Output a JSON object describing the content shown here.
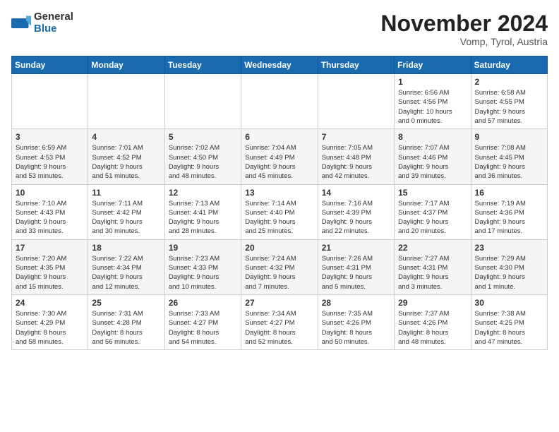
{
  "logo": {
    "general": "General",
    "blue": "Blue"
  },
  "header": {
    "month": "November 2024",
    "location": "Vomp, Tyrol, Austria"
  },
  "weekdays": [
    "Sunday",
    "Monday",
    "Tuesday",
    "Wednesday",
    "Thursday",
    "Friday",
    "Saturday"
  ],
  "weeks": [
    [
      {
        "day": "",
        "info": ""
      },
      {
        "day": "",
        "info": ""
      },
      {
        "day": "",
        "info": ""
      },
      {
        "day": "",
        "info": ""
      },
      {
        "day": "",
        "info": ""
      },
      {
        "day": "1",
        "info": "Sunrise: 6:56 AM\nSunset: 4:56 PM\nDaylight: 10 hours\nand 0 minutes."
      },
      {
        "day": "2",
        "info": "Sunrise: 6:58 AM\nSunset: 4:55 PM\nDaylight: 9 hours\nand 57 minutes."
      }
    ],
    [
      {
        "day": "3",
        "info": "Sunrise: 6:59 AM\nSunset: 4:53 PM\nDaylight: 9 hours\nand 53 minutes."
      },
      {
        "day": "4",
        "info": "Sunrise: 7:01 AM\nSunset: 4:52 PM\nDaylight: 9 hours\nand 51 minutes."
      },
      {
        "day": "5",
        "info": "Sunrise: 7:02 AM\nSunset: 4:50 PM\nDaylight: 9 hours\nand 48 minutes."
      },
      {
        "day": "6",
        "info": "Sunrise: 7:04 AM\nSunset: 4:49 PM\nDaylight: 9 hours\nand 45 minutes."
      },
      {
        "day": "7",
        "info": "Sunrise: 7:05 AM\nSunset: 4:48 PM\nDaylight: 9 hours\nand 42 minutes."
      },
      {
        "day": "8",
        "info": "Sunrise: 7:07 AM\nSunset: 4:46 PM\nDaylight: 9 hours\nand 39 minutes."
      },
      {
        "day": "9",
        "info": "Sunrise: 7:08 AM\nSunset: 4:45 PM\nDaylight: 9 hours\nand 36 minutes."
      }
    ],
    [
      {
        "day": "10",
        "info": "Sunrise: 7:10 AM\nSunset: 4:43 PM\nDaylight: 9 hours\nand 33 minutes."
      },
      {
        "day": "11",
        "info": "Sunrise: 7:11 AM\nSunset: 4:42 PM\nDaylight: 9 hours\nand 30 minutes."
      },
      {
        "day": "12",
        "info": "Sunrise: 7:13 AM\nSunset: 4:41 PM\nDaylight: 9 hours\nand 28 minutes."
      },
      {
        "day": "13",
        "info": "Sunrise: 7:14 AM\nSunset: 4:40 PM\nDaylight: 9 hours\nand 25 minutes."
      },
      {
        "day": "14",
        "info": "Sunrise: 7:16 AM\nSunset: 4:39 PM\nDaylight: 9 hours\nand 22 minutes."
      },
      {
        "day": "15",
        "info": "Sunrise: 7:17 AM\nSunset: 4:37 PM\nDaylight: 9 hours\nand 20 minutes."
      },
      {
        "day": "16",
        "info": "Sunrise: 7:19 AM\nSunset: 4:36 PM\nDaylight: 9 hours\nand 17 minutes."
      }
    ],
    [
      {
        "day": "17",
        "info": "Sunrise: 7:20 AM\nSunset: 4:35 PM\nDaylight: 9 hours\nand 15 minutes."
      },
      {
        "day": "18",
        "info": "Sunrise: 7:22 AM\nSunset: 4:34 PM\nDaylight: 9 hours\nand 12 minutes."
      },
      {
        "day": "19",
        "info": "Sunrise: 7:23 AM\nSunset: 4:33 PM\nDaylight: 9 hours\nand 10 minutes."
      },
      {
        "day": "20",
        "info": "Sunrise: 7:24 AM\nSunset: 4:32 PM\nDaylight: 9 hours\nand 7 minutes."
      },
      {
        "day": "21",
        "info": "Sunrise: 7:26 AM\nSunset: 4:31 PM\nDaylight: 9 hours\nand 5 minutes."
      },
      {
        "day": "22",
        "info": "Sunrise: 7:27 AM\nSunset: 4:31 PM\nDaylight: 9 hours\nand 3 minutes."
      },
      {
        "day": "23",
        "info": "Sunrise: 7:29 AM\nSunset: 4:30 PM\nDaylight: 9 hours\nand 1 minute."
      }
    ],
    [
      {
        "day": "24",
        "info": "Sunrise: 7:30 AM\nSunset: 4:29 PM\nDaylight: 8 hours\nand 58 minutes."
      },
      {
        "day": "25",
        "info": "Sunrise: 7:31 AM\nSunset: 4:28 PM\nDaylight: 8 hours\nand 56 minutes."
      },
      {
        "day": "26",
        "info": "Sunrise: 7:33 AM\nSunset: 4:27 PM\nDaylight: 8 hours\nand 54 minutes."
      },
      {
        "day": "27",
        "info": "Sunrise: 7:34 AM\nSunset: 4:27 PM\nDaylight: 8 hours\nand 52 minutes."
      },
      {
        "day": "28",
        "info": "Sunrise: 7:35 AM\nSunset: 4:26 PM\nDaylight: 8 hours\nand 50 minutes."
      },
      {
        "day": "29",
        "info": "Sunrise: 7:37 AM\nSunset: 4:26 PM\nDaylight: 8 hours\nand 48 minutes."
      },
      {
        "day": "30",
        "info": "Sunrise: 7:38 AM\nSunset: 4:25 PM\nDaylight: 8 hours\nand 47 minutes."
      }
    ]
  ]
}
